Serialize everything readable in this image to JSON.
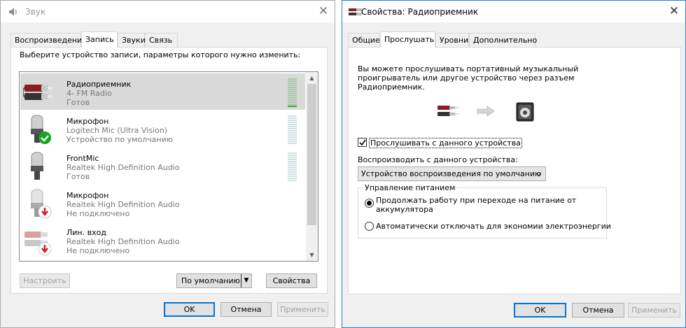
{
  "sound_dialog": {
    "title": "Звук",
    "tabs": [
      {
        "label": "Воспроизведение"
      },
      {
        "label": "Запись"
      },
      {
        "label": "Звуки"
      },
      {
        "label": "Связь"
      }
    ],
    "instruction": "Выберите устройство записи, параметры которого нужно изменить:",
    "devices": [
      {
        "name": "Радиоприемник",
        "line1": "4- FM Radio",
        "line2": "Готов",
        "icon": "rca-cable-icon",
        "selected": true,
        "meter_level": 0.1
      },
      {
        "name": "Микрофон",
        "line1": "Logitech Mic (Ultra Vision)",
        "line2": "Устройство по умолчанию",
        "icon": "microphone-default-icon",
        "selected": false,
        "meter_level": 0
      },
      {
        "name": "FrontMic",
        "line1": "Realtek High Definition Audio",
        "line2": "Готов",
        "icon": "microphone-icon",
        "selected": false,
        "meter_level": 0
      },
      {
        "name": "Микрофон",
        "line1": "Realtek High Definition Audio",
        "line2": "Не подключено",
        "icon": "microphone-unplugged-icon",
        "selected": false
      },
      {
        "name": "Лин. вход",
        "line1": "Realtek High Definition Audio",
        "line2": "Не подключено",
        "icon": "line-in-unplugged-icon",
        "selected": false
      }
    ],
    "configure_label": "Настроить",
    "default_label": "По умолчанию",
    "properties_label": "Свойства",
    "ok_label": "OK",
    "cancel_label": "Отмена",
    "apply_label": "Применить"
  },
  "props_dialog": {
    "title": "Свойства: Радиоприемник",
    "tabs": [
      {
        "label": "Общие"
      },
      {
        "label": "Прослушать"
      },
      {
        "label": "Уровни"
      },
      {
        "label": "Дополнительно"
      }
    ],
    "description_lines": [
      "Вы можете прослушивать портативный музыкальный",
      "проигрыватель или другое устройство через разъем",
      "Радиоприемник."
    ],
    "listen_checkbox_label": "Прослушивать с данного устройства",
    "listen_checked": true,
    "playback_label": "Воспроизводить с данного устройства:",
    "playback_value": "Устройство воспроизведения по умолчанию",
    "power_group_label": "Управление питанием",
    "power_option1_line1": "Продолжать работу при переходе на питание от",
    "power_option1_line2": "аккумулятора",
    "power_option2": "Автоматически отключать для экономии электроэнергии",
    "power_selected": 1,
    "ok_label": "OK",
    "cancel_label": "Отмена",
    "apply_label": "Применить"
  },
  "colors": {
    "accent": "#0078d7",
    "meter_active": "#2fa82f",
    "check_badge": "#18a322",
    "unplugged_badge": "#d21a1a"
  }
}
